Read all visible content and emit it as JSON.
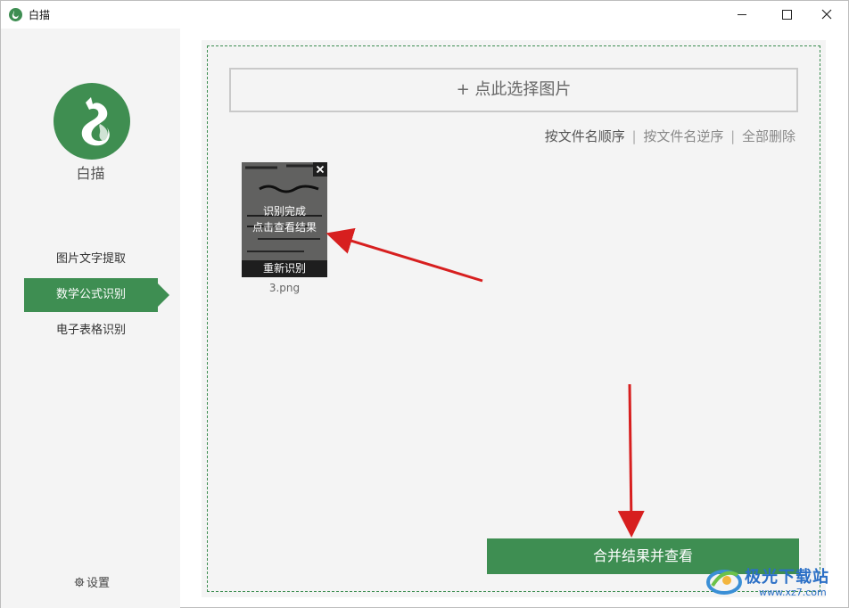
{
  "window": {
    "title": "白描"
  },
  "sidebar": {
    "app_name": "白描",
    "items": [
      {
        "label": "图片文字提取",
        "active": false
      },
      {
        "label": "数学公式识别",
        "active": true
      },
      {
        "label": "电子表格识别",
        "active": false
      }
    ],
    "settings_label": "设置"
  },
  "main": {
    "choose_button_label": "+ 点此选择图片",
    "sort_links": {
      "by_name_asc": "按文件名顺序",
      "separator": "|",
      "by_name_desc": "按文件名逆序",
      "delete_all": "全部删除"
    },
    "thumbnail": {
      "status": "识别完成",
      "view_hint": "点击查看结果",
      "redo_label": "重新识别",
      "filename": "3.png"
    },
    "merge_button_label": "合并结果并查看"
  },
  "watermark": {
    "brand": "极光下载站",
    "url": "www.xz7.com"
  },
  "colors": {
    "accent": "#3e8e52",
    "annotation_arrow": "#d71f1f",
    "sidebar_bg": "#f4f4f4"
  }
}
